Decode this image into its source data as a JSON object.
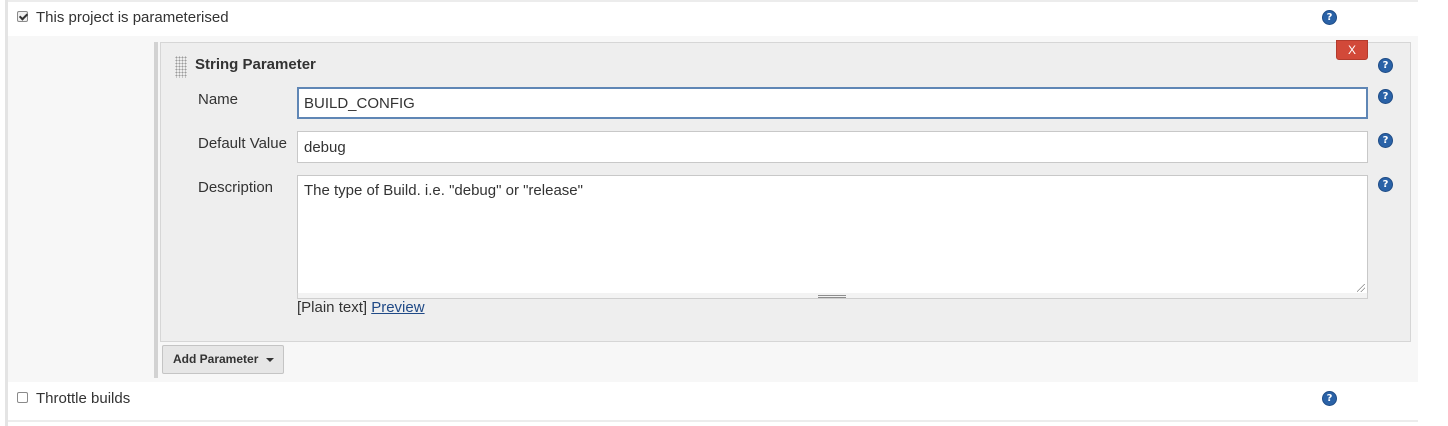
{
  "options": {
    "parameterised": {
      "label": "This project is parameterised",
      "checked": true
    },
    "throttle": {
      "label": "Throttle builds",
      "checked": false
    }
  },
  "help_icon": {
    "glyph": "?",
    "icon": "help-icon",
    "color": "#2a62a7"
  },
  "parameter": {
    "title": "String Parameter",
    "delete_label": "X",
    "delete_color": "#d24939",
    "fields": {
      "name": {
        "label": "Name",
        "value": "BUILD_CONFIG"
      },
      "default_value": {
        "label": "Default Value",
        "value": "debug"
      },
      "description": {
        "label": "Description",
        "value": "The type of Build. i.e. \"debug\" or \"release\""
      }
    },
    "format": {
      "plain_text": "[Plain text]",
      "preview": "Preview"
    }
  },
  "add_parameter": {
    "label": "Add Parameter",
    "icon": "caret-down-icon"
  }
}
